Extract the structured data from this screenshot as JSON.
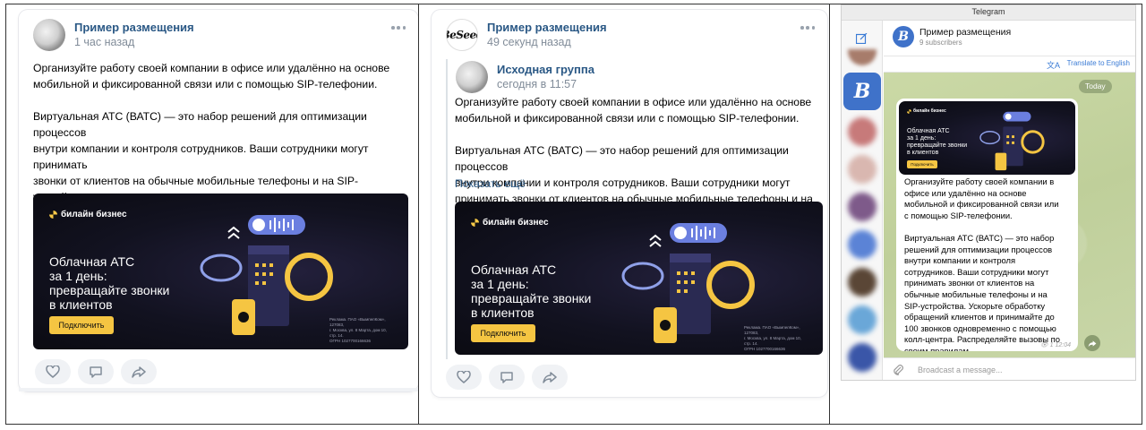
{
  "vk_post_1": {
    "author": "Пример размещения",
    "time": "1 час назад",
    "text": "Организуйте работу своей компании в офисе или удалённо на основе\nмобильной и фиксированной связи или с помощью SIP-телефонии.\n\nВиртуальная АТС (ВАТС) — это набор решений для оптимизации процессов\nвнутри компании и контроля сотрудников. Ваши сотрудники могут принимать\nзвонки от клиентов на обычные мобильные телефоны и на SIP-устройства.\nУскорьте обработку обращений клиентов и принимайте до 100 звонков\nодновременно с помощью колл-центра. Распределяйте вызовы по своим\nправилам"
  },
  "vk_post_2": {
    "author": "Пример размещения",
    "time": "49 секунд назад",
    "avatar_text": "BeSeed",
    "repost_author": "Исходная группа",
    "repost_time": "сегодня в 11:57",
    "text": "Организуйте работу своей компании в офисе или удалённо на основе\nмобильной и фиксированной связи или с помощью SIP-телефонии.\n\nВиртуальная АТС (ВАТС) — это набор решений для оптимизации процессов\nвнутри компании и контроля сотрудников. Ваши сотрудники могут\nпринимать звонки от клиентов на обычные мобильные телефоны и на",
    "show_more": "Показать ещё"
  },
  "banner": {
    "brand": "билайн бизнес",
    "title": "Облачная АТС\nза 1 день:\nпревращайте звонки\nв клиентов",
    "button": "Подключить",
    "legal": "Реклама. ПАО «ВымпелКом», 127083,\nг. Москва, ул. 8 Марта, дом 10, стр. 14.\nОГРН 1027700166636"
  },
  "telegram": {
    "window_title": "Telegram",
    "channel_name": "Пример размещения",
    "subscribers": "9 subscribers",
    "translate": "Translate to English",
    "date_badge": "Today",
    "message_text": "Организуйте работу своей компании в\nофисе или удалённо на основе\nмобильной и фиксированной связи или\nс помощью SIP-телефонии.\n\nВиртуальная АТС (ВАТС) — это набор\nрешений для оптимизации процессов\nвнутри компании и контроля\nсотрудников. Ваши сотрудники могут\nпринимать звонки от клиентов на\nобычные мобильные телефоны и на\nSIP-устройства. Ускорьте обработку\nобращений клиентов и принимайте до\n100 звонков одновременно с помощью\nколл-центра. Распределяйте вызовы по\nсвоим правилам.",
    "views_time": "1 12:04",
    "input_placeholder": "Broadcast a message...",
    "avatar_letter": "B"
  },
  "colors": {
    "vk_link": "#2a5885",
    "banner_button": "#f5c542",
    "telegram_accent": "#3f72c9"
  }
}
